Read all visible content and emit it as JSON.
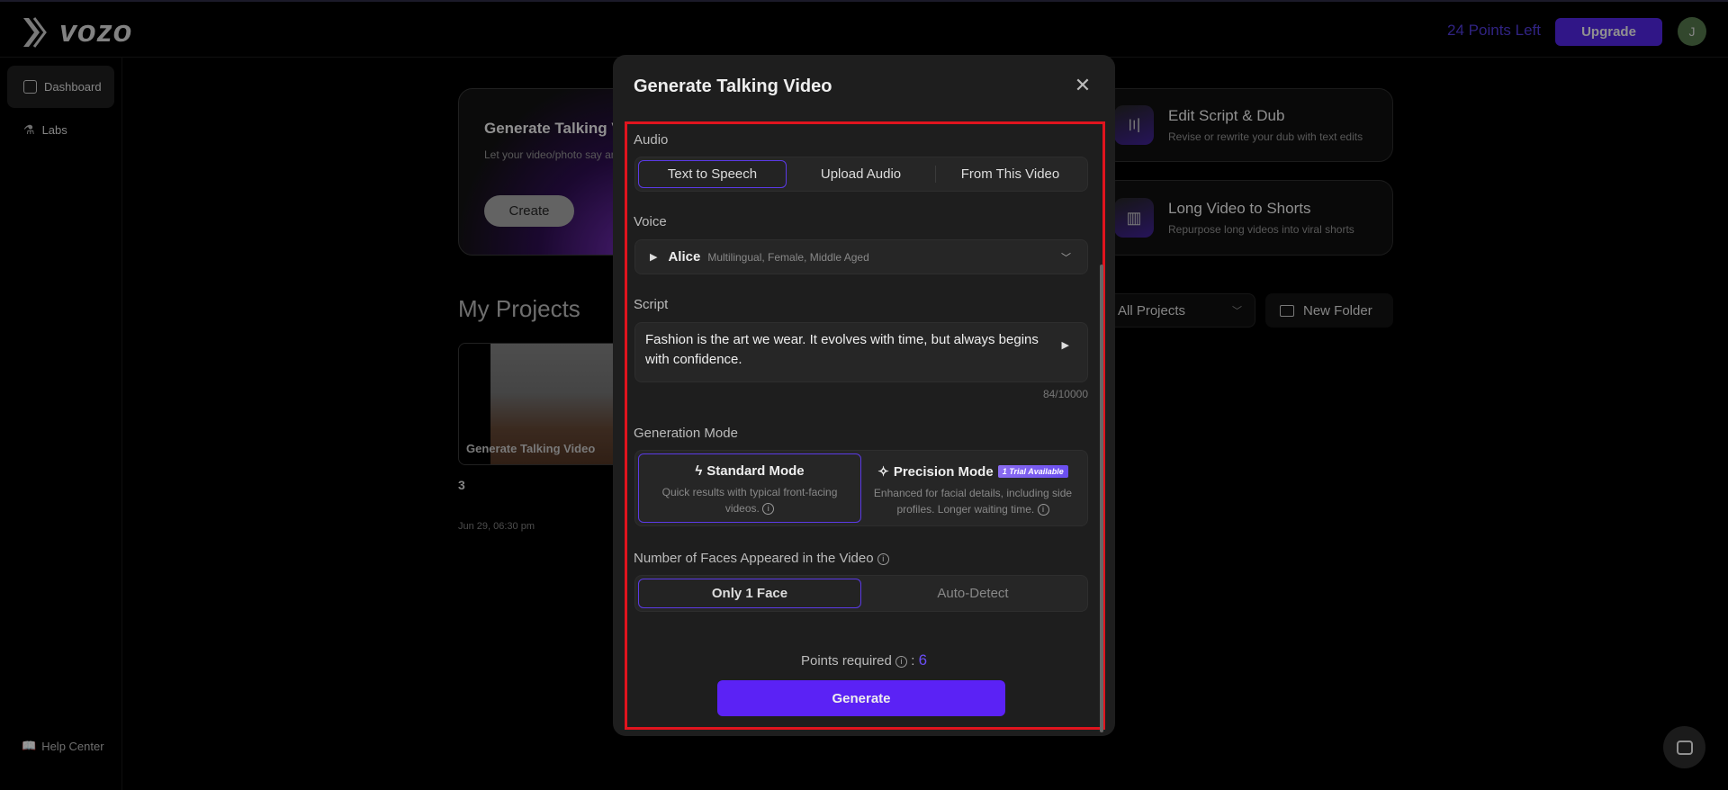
{
  "header": {
    "logo": "vozo",
    "points_left": "24 Points Left",
    "upgrade": "Upgrade",
    "avatar_initial": "J"
  },
  "sidebar": {
    "items": [
      {
        "label": "Dashboard"
      },
      {
        "label": "Labs"
      }
    ],
    "help": "Help Center"
  },
  "main": {
    "hero_card": {
      "title": "Generate Talking Video",
      "subtitle": "Let your video/photo say anything",
      "button": "Create"
    },
    "tools": [
      {
        "title": "Edit Script & Dub",
        "subtitle": "Revise or rewrite your dub with text edits"
      },
      {
        "title": "Long Video to Shorts",
        "subtitle": "Repurpose long videos into viral shorts"
      }
    ],
    "my_projects": "My Projects",
    "filter": "All Projects",
    "new_folder": "New Folder",
    "projects": [
      {
        "thumb_label": "Generate Talking Video",
        "name": "3",
        "date": "Jun 29, 06:30 pm"
      }
    ]
  },
  "modal": {
    "title": "Generate Talking Video",
    "audio_label": "Audio",
    "audio_options": [
      "Text to Speech",
      "Upload Audio",
      "From This Video"
    ],
    "audio_selected": "Text to Speech",
    "voice_label": "Voice",
    "voice_name": "Alice",
    "voice_desc": "Multilingual, Female, Middle Aged",
    "script_label": "Script",
    "script_text": "Fashion is the art we wear. It evolves with time, but always begins with confidence.",
    "script_count": "84/10000",
    "gen_mode_label": "Generation Mode",
    "modes": [
      {
        "title": "Standard Mode",
        "desc": "Quick results with typical front-facing videos."
      },
      {
        "title": "Precision Mode",
        "badge": "1 Trial Available",
        "desc": "Enhanced for facial details, including side profiles. Longer waiting time."
      }
    ],
    "faces_label": "Number of Faces Appeared in the Video",
    "faces_options": [
      "Only 1 Face",
      "Auto-Detect"
    ],
    "points_required_label": "Points required",
    "points_required": "6",
    "generate": "Generate"
  },
  "colors": {
    "accent": "#5b22f5",
    "highlight": "#e0141e"
  }
}
